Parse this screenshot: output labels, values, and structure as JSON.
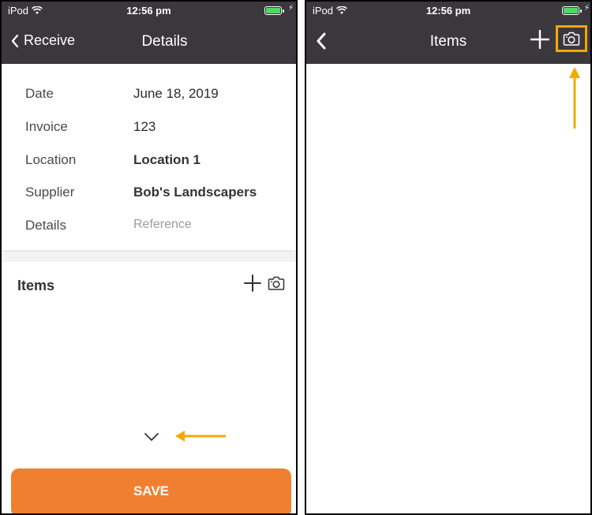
{
  "left": {
    "status": {
      "carrier": "iPod",
      "time": "12:56 pm"
    },
    "nav": {
      "back_label": "Receive",
      "title": "Details"
    },
    "details": [
      {
        "label": "Date",
        "value": "June 18, 2019",
        "style": "normal"
      },
      {
        "label": "Invoice",
        "value": "123",
        "style": "normal"
      },
      {
        "label": "Location",
        "value": "Location 1",
        "style": "bold"
      },
      {
        "label": "Supplier",
        "value": "Bob's Landscapers",
        "style": "bold"
      },
      {
        "label": "Details",
        "value": "Reference",
        "style": "placeholder"
      }
    ],
    "items": {
      "header": "Items"
    },
    "save_label": "SAVE"
  },
  "right": {
    "status": {
      "carrier": "iPod",
      "time": "12:56 pm"
    },
    "nav": {
      "title": "Items"
    }
  },
  "icons": {
    "back": "chevron-left-icon",
    "add": "plus-icon",
    "camera": "camera-icon",
    "expand": "chevron-down-icon",
    "annotation_left": "arrow-left-icon",
    "annotation_up": "arrow-up-icon"
  },
  "colors": {
    "nav_bar": "#3b383d",
    "accent_orange": "#f08030",
    "annotation": "#f2a900",
    "battery": "#4cd964"
  }
}
